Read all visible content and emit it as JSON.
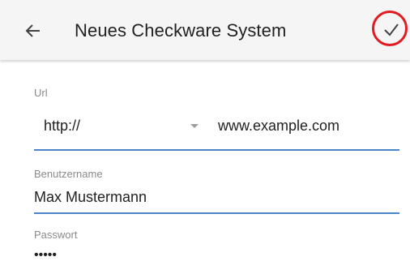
{
  "header": {
    "title": "Neues Checkware System",
    "back_icon": "arrow-left-icon",
    "confirm_icon": "check-icon",
    "highlight_color": "#e11b22"
  },
  "form": {
    "url": {
      "label": "Url",
      "protocol": "http://",
      "value": "www.example.com"
    },
    "username": {
      "label": "Benutzername",
      "value": "Max Mustermann"
    },
    "password": {
      "label": "Passwort",
      "value": "•••••"
    }
  },
  "colors": {
    "accent": "#4a86c8",
    "app_bar": "#f5f5f5"
  }
}
